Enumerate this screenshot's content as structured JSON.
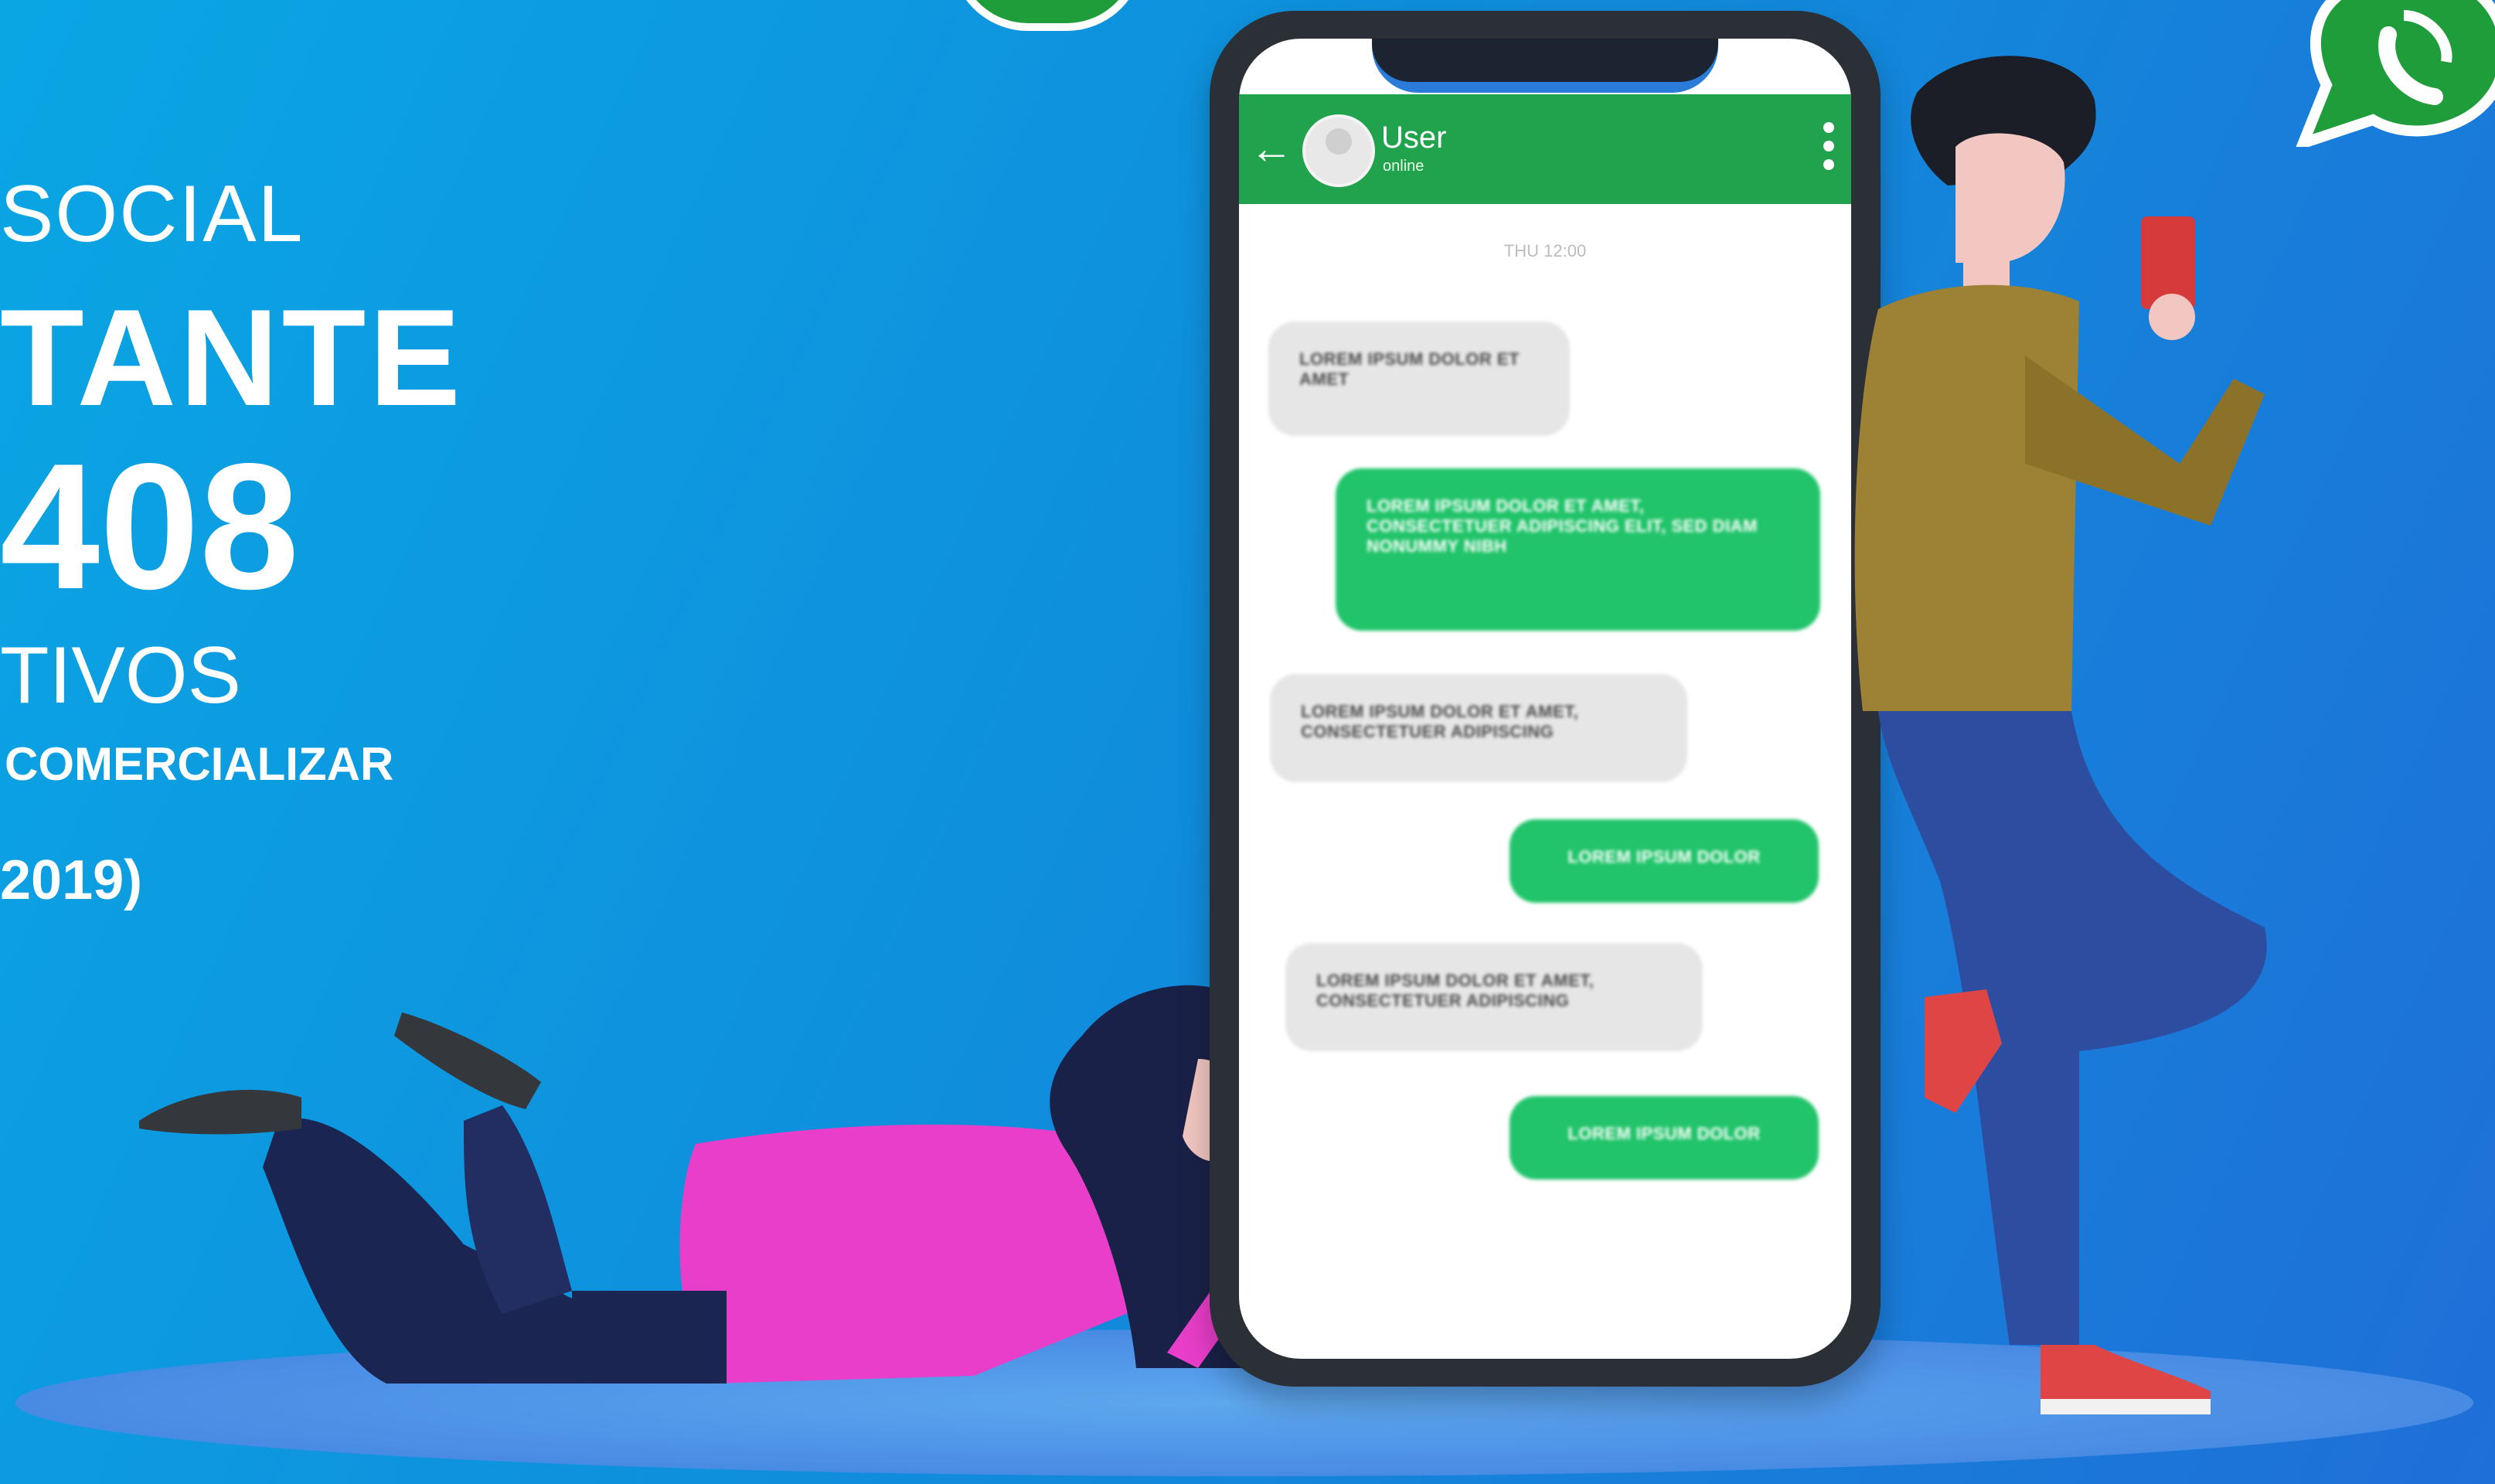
{
  "headline": {
    "line1": "SOCIAL",
    "line2": "TANTE",
    "line3": "408",
    "line4": "TIVOS",
    "line5": "COMERCIALIZAR",
    "line6": "2019)"
  },
  "chat": {
    "header": {
      "name": "User",
      "status": "online"
    },
    "timestamp": "THU 12:00",
    "messages": [
      {
        "direction": "incoming",
        "text": "LOREM IPSUM DOLOR ET AMET"
      },
      {
        "direction": "outgoing",
        "text": "LOREM IPSUM DOLOR ET AMET, CONSECTETUER ADIPISCING ELIT, SED DIAM NONUMMY NIBH"
      },
      {
        "direction": "incoming",
        "text": "LOREM IPSUM DOLOR ET AMET, CONSECTETUER ADIPISCING"
      },
      {
        "direction": "outgoing",
        "text": "LOREM IPSUM DOLOR"
      },
      {
        "direction": "incoming",
        "text": "LOREM IPSUM DOLOR ET AMET, CONSECTETUER ADIPISCING"
      },
      {
        "direction": "outgoing",
        "text": "LOREM IPSUM DOLOR"
      }
    ]
  },
  "colors": {
    "background": "#1190dd",
    "appbar": "#21a24d",
    "outgoing_bubble": "#21c46a",
    "incoming_bubble": "#e6e6e6"
  }
}
